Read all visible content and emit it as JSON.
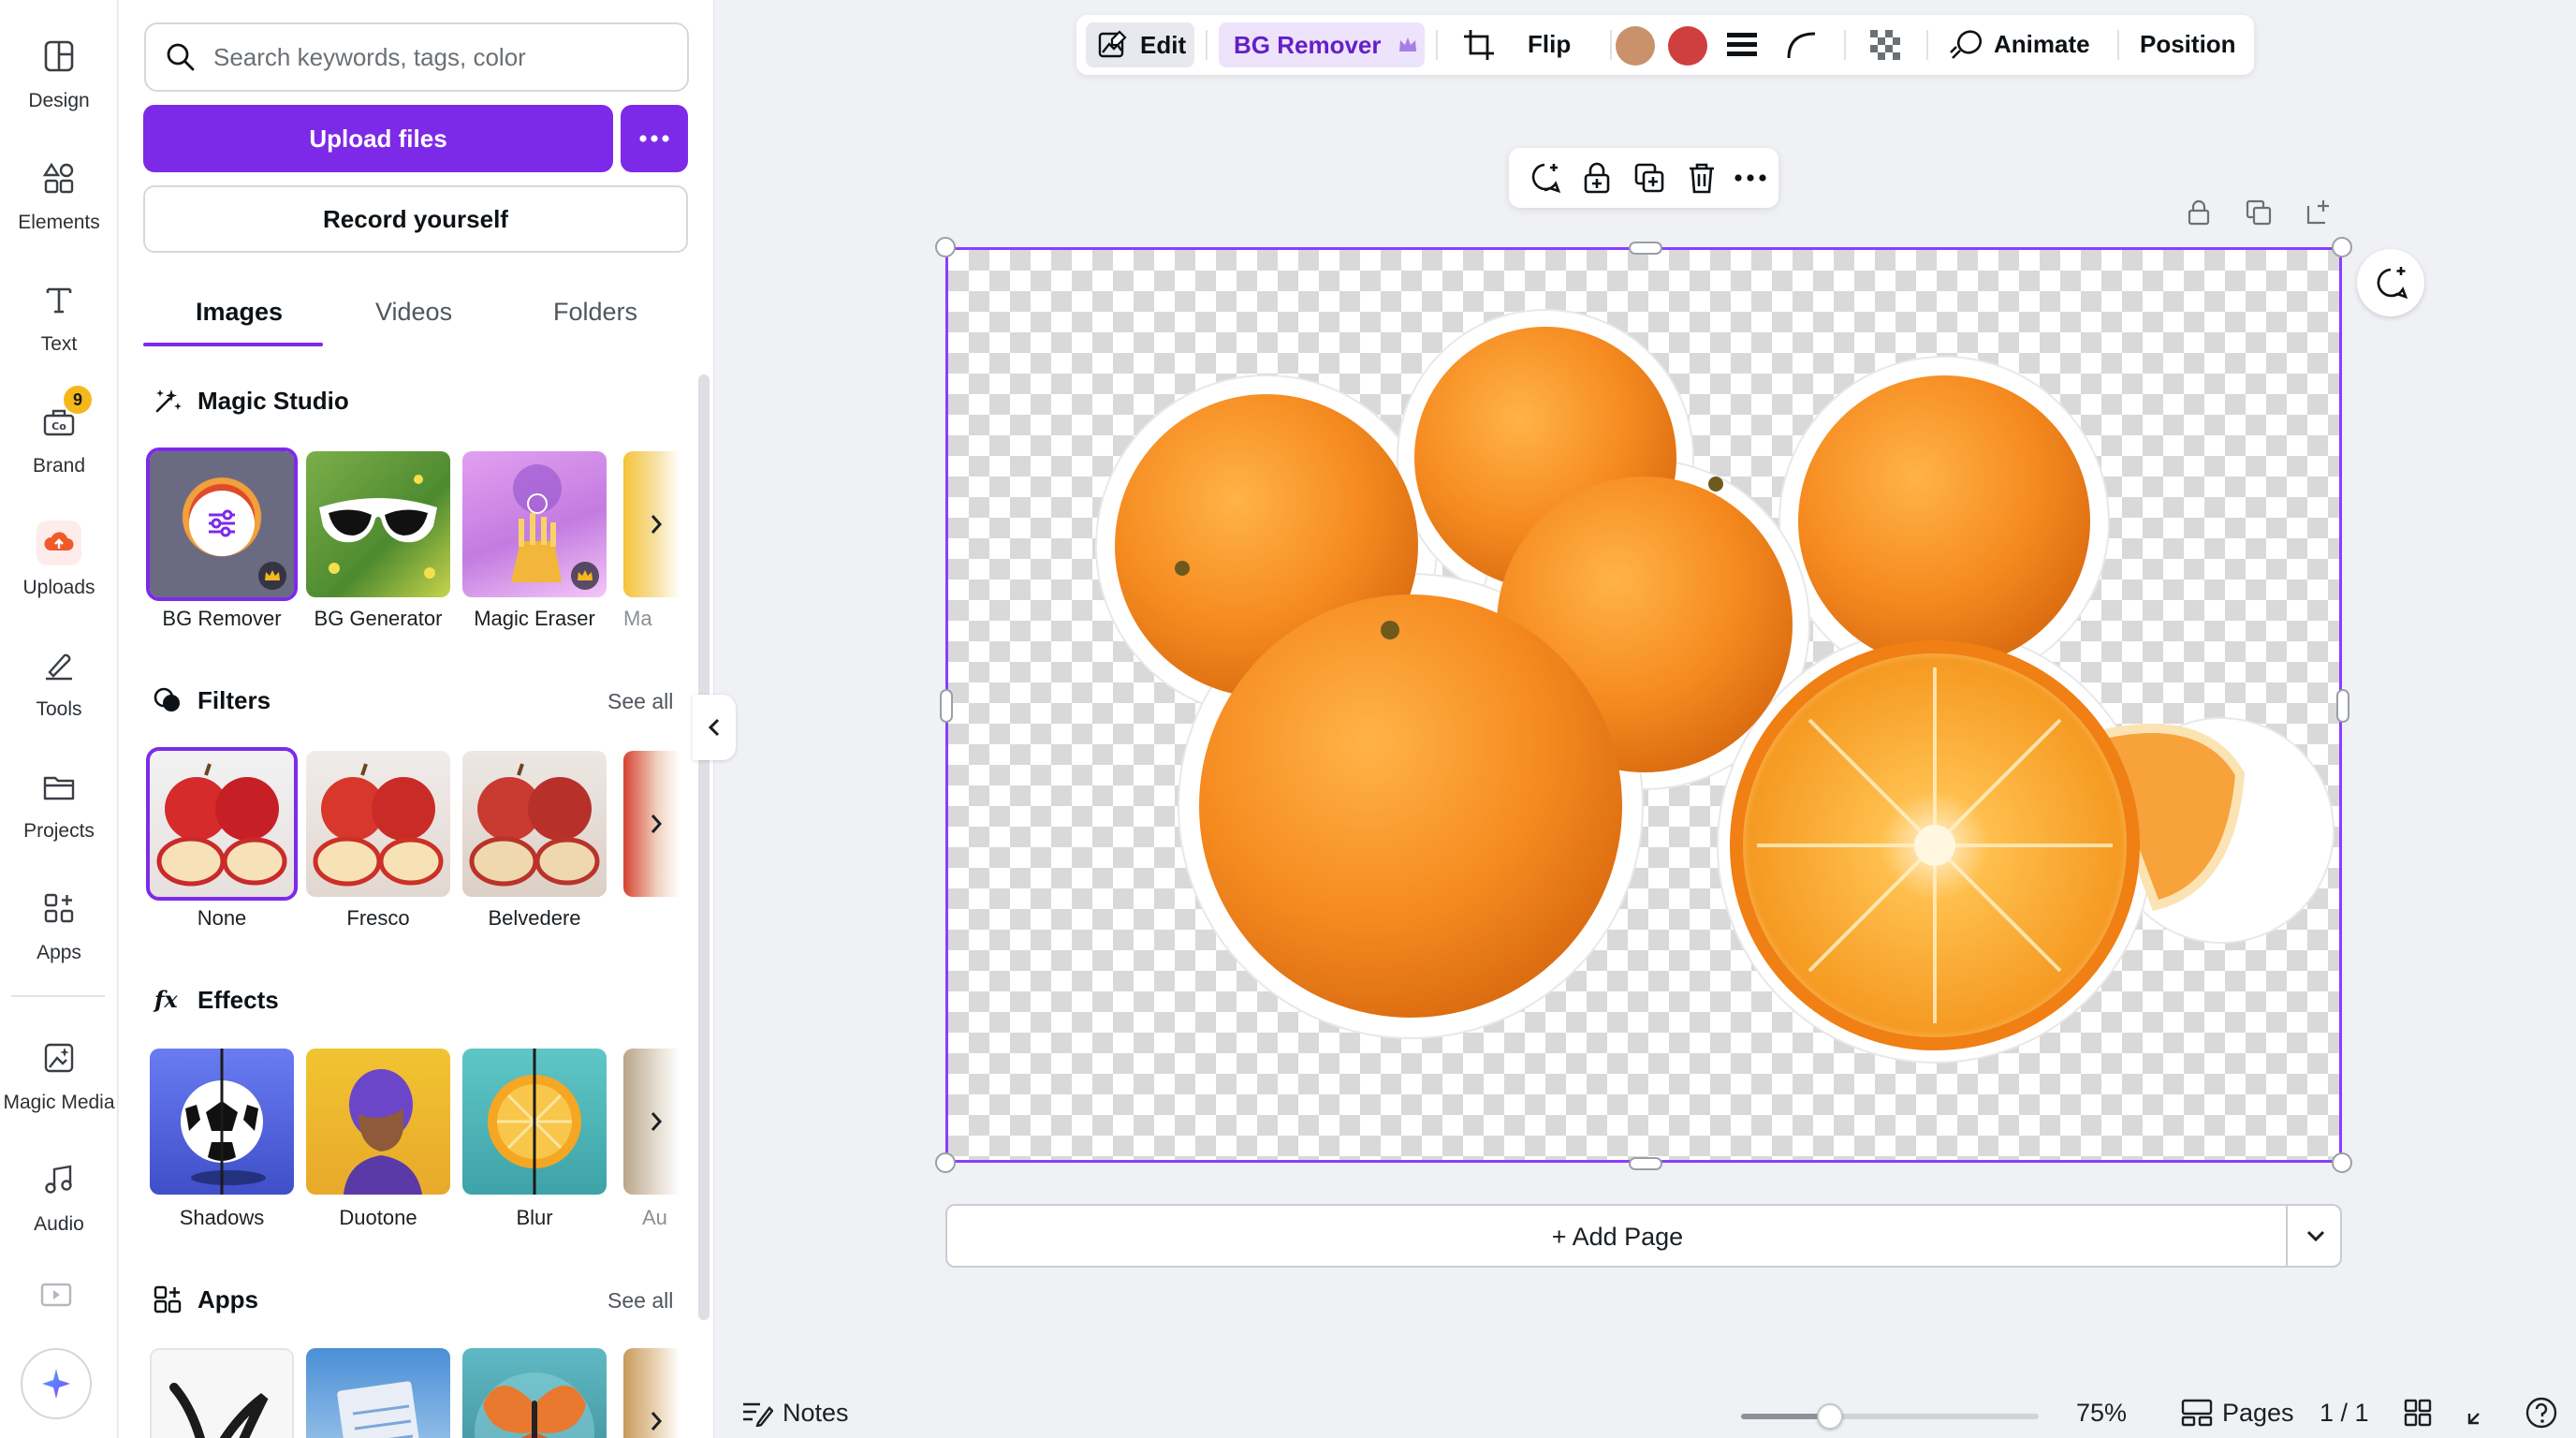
{
  "sidebar": {
    "items": [
      {
        "label": "Design",
        "icon": "design-icon"
      },
      {
        "label": "Elements",
        "icon": "elements-icon"
      },
      {
        "label": "Text",
        "icon": "text-icon"
      },
      {
        "label": "Brand",
        "icon": "brand-icon",
        "badge": "9"
      },
      {
        "label": "Uploads",
        "icon": "uploads-icon"
      },
      {
        "label": "Tools",
        "icon": "tools-icon"
      },
      {
        "label": "Projects",
        "icon": "projects-icon"
      },
      {
        "label": "Apps",
        "icon": "apps-icon"
      },
      {
        "label": "Magic Media",
        "icon": "magic-media-icon"
      },
      {
        "label": "Audio",
        "icon": "audio-icon"
      }
    ]
  },
  "panel": {
    "search_placeholder": "Search keywords, tags, color",
    "upload_label": "Upload files",
    "record_label": "Record yourself",
    "tabs": [
      {
        "label": "Images",
        "active": true
      },
      {
        "label": "Videos",
        "active": false
      },
      {
        "label": "Folders",
        "active": false
      }
    ],
    "magic_studio": {
      "title": "Magic Studio",
      "items": [
        {
          "label": "BG Remover",
          "selected": true
        },
        {
          "label": "BG Generator"
        },
        {
          "label": "Magic Eraser"
        },
        {
          "label": "Ma"
        }
      ]
    },
    "filters": {
      "title": "Filters",
      "see_all": "See all",
      "items": [
        {
          "label": "None",
          "selected": true
        },
        {
          "label": "Fresco"
        },
        {
          "label": "Belvedere"
        }
      ]
    },
    "effects": {
      "title": "Effects",
      "items": [
        {
          "label": "Shadows"
        },
        {
          "label": "Duotone"
        },
        {
          "label": "Blur"
        },
        {
          "label": "Au"
        }
      ]
    },
    "apps": {
      "title": "Apps",
      "see_all": "See all"
    }
  },
  "toolbar": {
    "edit_label": "Edit",
    "bg_remover_label": "BG Remover",
    "flip_label": "Flip",
    "animate_label": "Animate",
    "position_label": "Position",
    "swatches": [
      "#c9926a",
      "#cf3f3f"
    ]
  },
  "canvas": {
    "add_page_label": "+ Add Page"
  },
  "bottom": {
    "notes_label": "Notes",
    "zoom_label": "75%",
    "zoom_level": 0.3,
    "pages_label": "Pages",
    "page_count": "1 / 1"
  },
  "colors": {
    "accent": "#7d2ae8",
    "selection": "#8b3dff"
  }
}
